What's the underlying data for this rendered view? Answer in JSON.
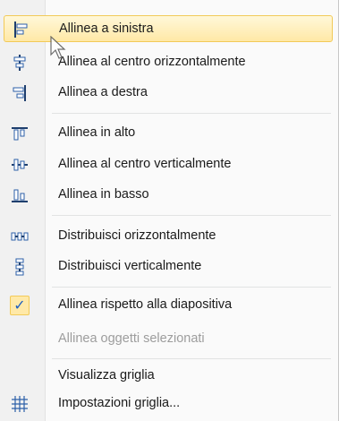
{
  "menu": {
    "items": [
      {
        "label": "Allinea a sinistra",
        "icon": "align-left-icon"
      },
      {
        "label": "Allinea al centro orizzontalmente",
        "icon": "align-center-horizontal-icon"
      },
      {
        "label": "Allinea a destra",
        "icon": "align-right-icon"
      },
      {
        "label": "Allinea in alto",
        "icon": "align-top-icon"
      },
      {
        "label": "Allinea al centro verticalmente",
        "icon": "align-middle-vertical-icon"
      },
      {
        "label": "Allinea in basso",
        "icon": "align-bottom-icon"
      },
      {
        "label": "Distribuisci orizzontalmente",
        "icon": "distribute-horizontal-icon"
      },
      {
        "label": "Distribuisci verticalmente",
        "icon": "distribute-vertical-icon"
      },
      {
        "label": "Allinea rispetto alla diapositiva",
        "icon": "check-icon",
        "checked": true
      },
      {
        "label": "Allinea oggetti selezionati",
        "disabled": true
      },
      {
        "label": "Visualizza griglia"
      },
      {
        "label": "Impostazioni griglia...",
        "icon": "grid-icon"
      }
    ],
    "highlight_color": "#ffe8a6",
    "check_color": "#1d5fc1"
  }
}
